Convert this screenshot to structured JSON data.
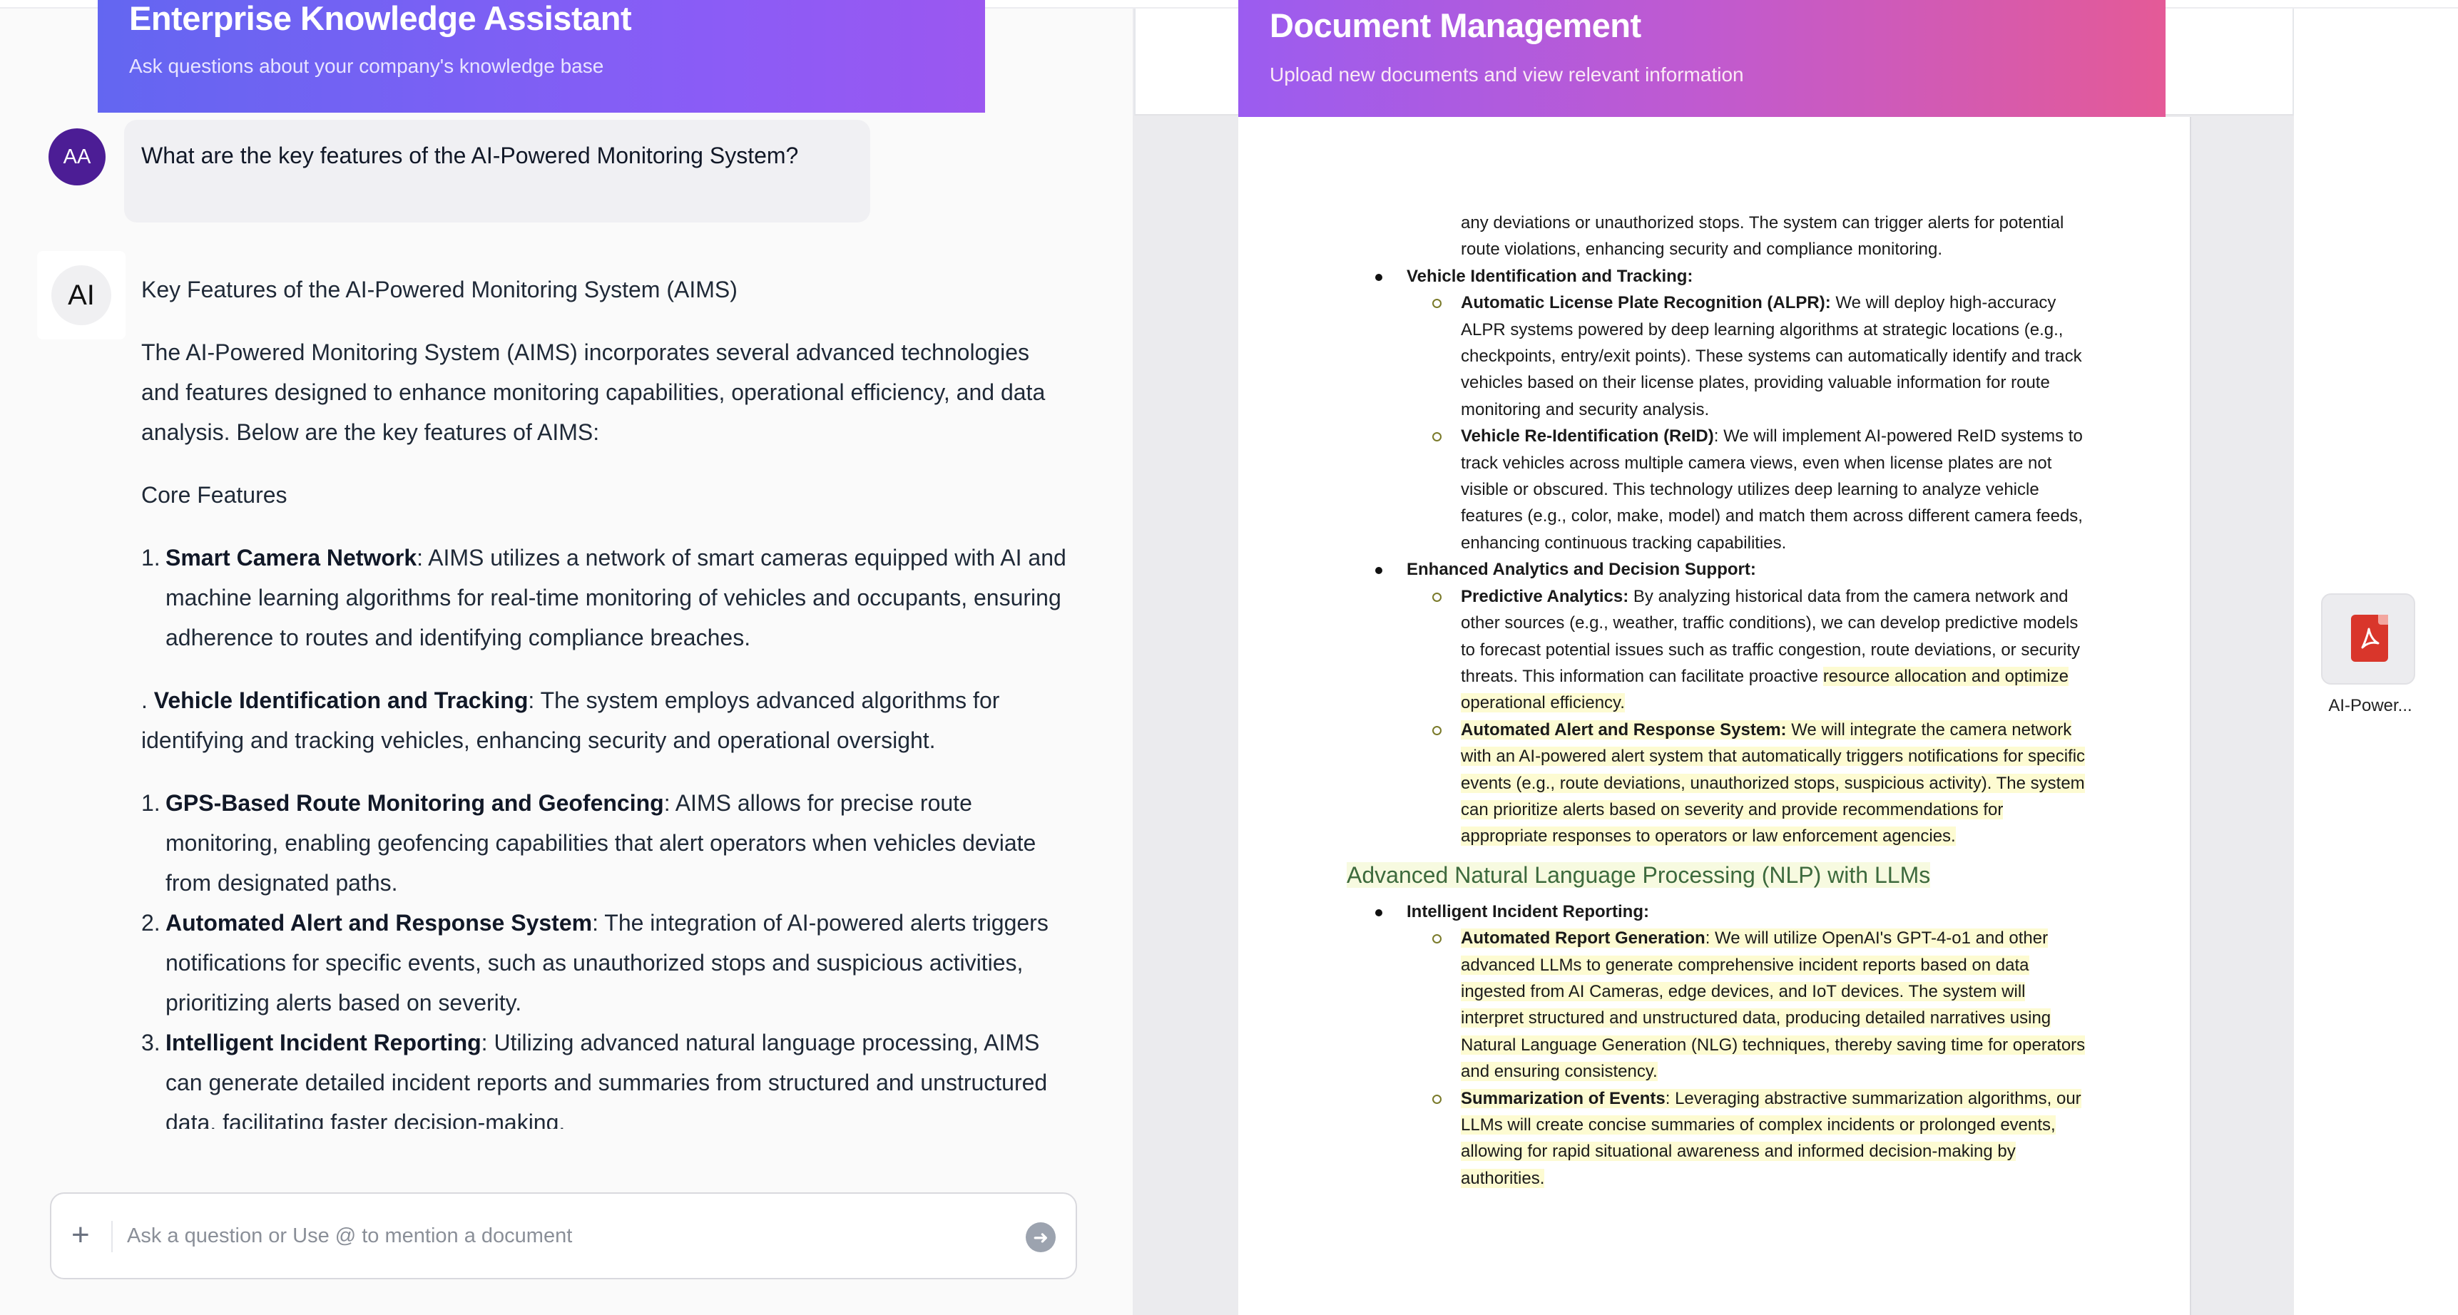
{
  "chat": {
    "header": {
      "title": "Enterprise Knowledge Assistant",
      "subtitle": "Ask questions about your company's knowledge base"
    },
    "user_message": {
      "avatar_initials": "AA",
      "text": "What are the key features of the AI-Powered Monitoring System?"
    },
    "ai_message": {
      "avatar_text": "AI",
      "title": "Key Features of the AI-Powered Monitoring System (AIMS)",
      "intro": "The AI-Powered Monitoring System (AIMS) incorporates several advanced technologies and features designed to enhance monitoring capabilities, operational efficiency, and data analysis. Below are the key features of AIMS:",
      "section": "Core Features",
      "item_a": {
        "num": "1.",
        "bold": "Smart Camera Network",
        "text": ": AIMS utilizes a network of smart cameras equipped with AI and machine learning algorithms for real-time monitoring of vehicles and occupants, ensuring adherence to routes and identifying compliance breaches."
      },
      "item_b": {
        "prefix": ". ",
        "bold": "Vehicle Identification and Tracking",
        "text": ": The system employs advanced algorithms for identifying and tracking vehicles, enhancing security and operational oversight."
      },
      "list2": [
        {
          "num": "1.",
          "bold": "GPS-Based Route Monitoring and Geofencing",
          "text": ": AIMS allows for precise route monitoring, enabling geofencing capabilities that alert operators when vehicles deviate from designated paths."
        },
        {
          "num": "2.",
          "bold": "Automated Alert and Response System",
          "text": ": The integration of AI-powered alerts triggers notifications for specific events, such as unauthorized stops and suspicious activities, prioritizing alerts based on severity."
        },
        {
          "num": "3.",
          "bold": "Intelligent Incident Reporting",
          "text": ": Utilizing advanced natural language processing, AIMS can generate detailed incident reports and summaries from structured and unstructured data, facilitating faster decision-making."
        }
      ]
    },
    "input": {
      "placeholder": "Ask a question or Use @ to mention a document"
    }
  },
  "documents": {
    "header": {
      "title": "Document Management",
      "subtitle": "Upload new documents and view relevant information"
    },
    "page": {
      "top_cont": "any deviations or unauthorized stops. The system can trigger alerts for potential route violations, enhancing security and compliance monitoring.",
      "sec1": {
        "title": "Vehicle Identification and Tracking:",
        "items": [
          {
            "bold": "Automatic License Plate Recognition (ALPR):",
            "text": " We will deploy high-accuracy ALPR systems powered by deep learning algorithms at strategic locations (e.g., checkpoints, entry/exit points). These systems can automatically identify and track vehicles based on their license plates, providing valuable information for route monitoring and security analysis."
          },
          {
            "bold": "Vehicle Re-Identification (ReID)",
            "text": ": We will implement AI-powered ReID systems to track vehicles across multiple camera views, even when license plates are not visible or obscured. This technology utilizes deep learning to analyze vehicle features (e.g., color, make, model) and match them across different camera feeds, enhancing continuous tracking capabilities."
          }
        ]
      },
      "sec2": {
        "title": "Enhanced Analytics and Decision Support:",
        "item1": {
          "bold": "Predictive Analytics:",
          "text": " By analyzing historical data from the camera network and other sources (e.g., weather, traffic conditions), we can develop predictive models to forecast potential issues such as traffic congestion, route deviations, or security threats. This information can facilitate proactive",
          "hl_tail": "resource allocation and optimize operational efficiency."
        },
        "item2": {
          "bold": "Automated Alert and Response System:",
          "text": " We will integrate the camera network with an AI-powered alert system that automatically triggers notifications for specific events (e.g., route deviations, unauthorized stops, suspicious activity). The system can prioritize alerts based on severity and provide recommendations for appropriate responses to operators or law enforcement agencies."
        }
      },
      "heading": "Advanced Natural Language Processing (NLP) with LLMs",
      "sec3": {
        "title": "Intelligent Incident Reporting:",
        "items": [
          {
            "bold": "Automated Report Generation",
            "text": ": We will utilize OpenAI's GPT-4-o1 and other advanced LLMs to generate comprehensive incident reports based on data ingested from AI Cameras, edge devices, and IoT devices. The system will interpret structured and unstructured data, producing detailed narratives using Natural Language Generation (NLG) techniques, thereby saving time for operators and ensuring consistency."
          },
          {
            "bold": "Summarization of Events",
            "text": ": Leveraging abstractive summarization algorithms, our LLMs will create concise summaries of complex incidents or prolonged events, allowing for rapid situational awareness and informed decision-making by authorities."
          }
        ]
      }
    },
    "file": {
      "icon": "pdf-file-icon",
      "name": "AI-Power..."
    }
  },
  "colors": {
    "chat_header_start": "#6366f1",
    "chat_header_end": "#9b57f0",
    "doc_header_start": "#9b5cf0",
    "doc_header_end": "#e45a97",
    "highlight": "#fdfbd2",
    "doc_heading": "#3d6a3d",
    "pdf_red": "#d9362b"
  }
}
